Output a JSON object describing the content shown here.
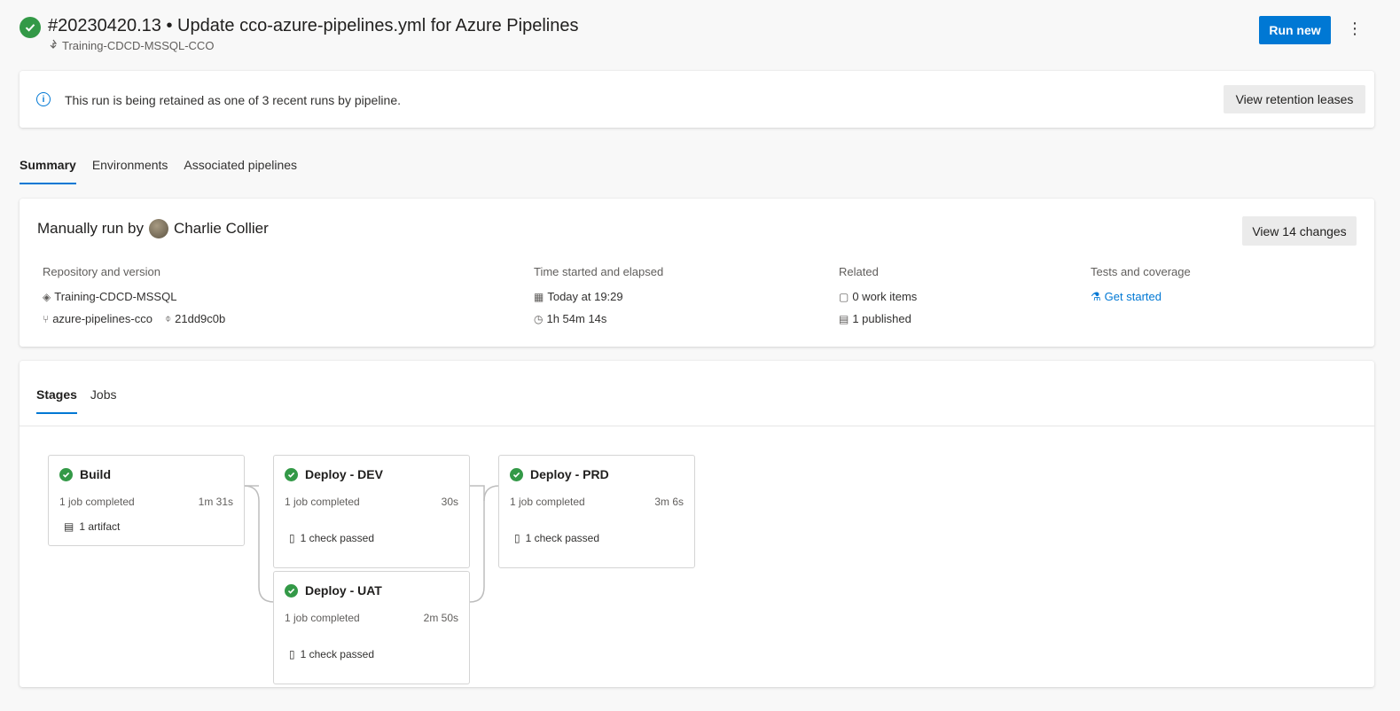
{
  "header": {
    "title": "#20230420.13 • Update cco-azure-pipelines.yml for Azure Pipelines",
    "pipeline": "Training-CDCD-MSSQL-CCO",
    "run_new": "Run new",
    "more": "⋮"
  },
  "banner": {
    "text": "This run is being retained as one of 3 recent runs by pipeline.",
    "button": "View retention leases"
  },
  "tabs": [
    "Summary",
    "Environments",
    "Associated pipelines"
  ],
  "summary": {
    "run_by_prefix": "Manually run by",
    "run_by_user": "Charlie Collier",
    "changes_button": "View 14 changes",
    "repo": {
      "heading": "Repository and version",
      "repository": "Training-CDCD-MSSQL",
      "branch": "azure-pipelines-cco",
      "commit": "21dd9c0b"
    },
    "time": {
      "heading": "Time started and elapsed",
      "started": "Today at 19:29",
      "elapsed": "1h 54m 14s"
    },
    "related": {
      "heading": "Related",
      "work_items": "0 work items",
      "published": "1 published"
    },
    "tests": {
      "heading": "Tests and coverage",
      "link": "Get started"
    }
  },
  "stages_tabs": [
    "Stages",
    "Jobs"
  ],
  "stages": [
    {
      "name": "Build",
      "jobs": "1 job completed",
      "duration": "1m 31s",
      "extra": "1 artifact"
    },
    {
      "name": "Deploy - DEV",
      "jobs": "1 job completed",
      "duration": "30s",
      "extra": "1 check passed"
    },
    {
      "name": "Deploy - PRD",
      "jobs": "1 job completed",
      "duration": "3m 6s",
      "extra": "1 check passed"
    },
    {
      "name": "Deploy - UAT",
      "jobs": "1 job completed",
      "duration": "2m 50s",
      "extra": "1 check passed"
    }
  ],
  "colors": {
    "accent": "#0078d4",
    "success": "#339947",
    "background": "#f8f8f8"
  },
  "icons": {
    "status": "check-circle-icon",
    "pipeline": "pipeline-icon",
    "info": "info-icon",
    "repo": "repo-icon",
    "branch": "branch-icon",
    "commit": "commit-icon",
    "calendar": "calendar-icon",
    "clock": "clock-icon",
    "work_items": "work-items-icon",
    "artifact": "artifact-icon",
    "beaker": "beaker-icon",
    "check_list": "checklist-icon"
  }
}
